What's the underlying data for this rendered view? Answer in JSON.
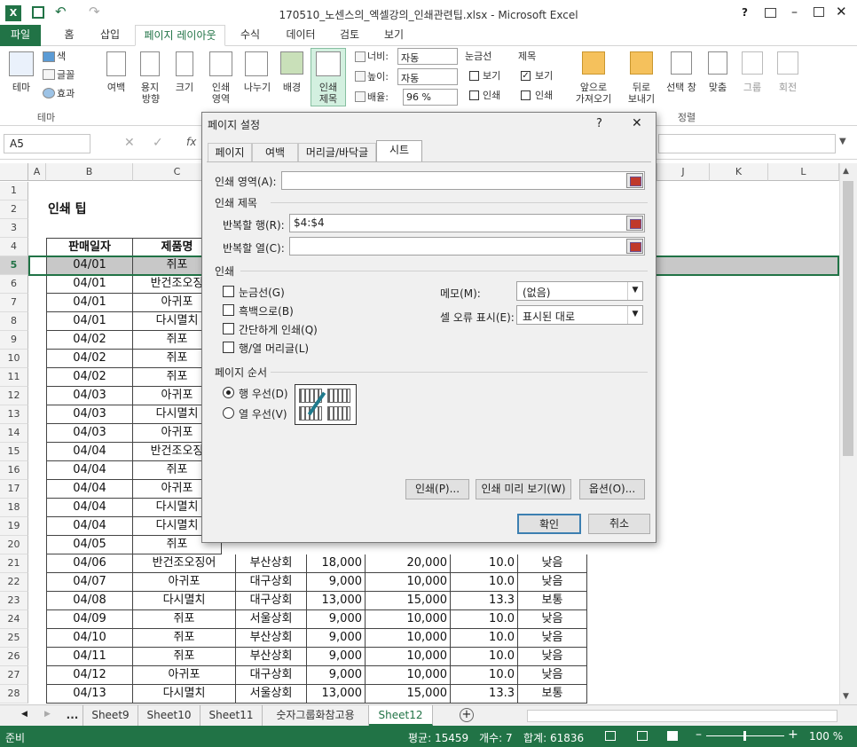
{
  "titlebar": {
    "title": "170510_노센스의_엑셀강의_인쇄관련팁.xlsx - Microsoft Excel",
    "help": "?"
  },
  "tabs": [
    "파일",
    "홈",
    "삽입",
    "페이지 레이아웃",
    "수식",
    "데이터",
    "검토",
    "보기"
  ],
  "ribbon": {
    "theme": {
      "main": "테마",
      "colors": "색",
      "fonts": "글꼴",
      "effects": "효과",
      "group": "테마"
    },
    "setup": {
      "margins": "여백",
      "orientation1": "용지",
      "orientation2": "방향",
      "size": "크기",
      "printarea1": "인쇄",
      "printarea2": "영역",
      "breaks": "나누기",
      "background": "배경",
      "titles1": "인쇄",
      "titles2": "제목"
    },
    "scale": {
      "width_label": "너비:",
      "width_value": "자동",
      "height_label": "높이:",
      "height_value": "자동",
      "scale_label": "배율:",
      "scale_value": "96 %"
    },
    "sheetopts": {
      "gridlines": "눈금선",
      "headings": "제목",
      "view": "보기",
      "print": "인쇄"
    },
    "arrange": {
      "forward1": "앞으로",
      "forward2": "가져오기",
      "backward1": "뒤로",
      "backward2": "보내기",
      "selection": "선택 창",
      "align": "맞춤",
      "group": "그룹",
      "rotate": "회전",
      "group_label": "정렬"
    }
  },
  "formula": {
    "namebox": "A5",
    "fx": "fx"
  },
  "columns": [
    "A",
    "B",
    "C",
    "J",
    "K",
    "L"
  ],
  "rows": [
    {
      "n": "1",
      "b": "",
      "c": ""
    },
    {
      "n": "2",
      "b": "인쇄 팁",
      "c": ""
    },
    {
      "n": "3",
      "b": "",
      "c": ""
    },
    {
      "n": "4",
      "b": "판매일자",
      "c": "제품명"
    },
    {
      "n": "5",
      "b": "04/01",
      "c": "쥐포"
    },
    {
      "n": "6",
      "b": "04/01",
      "c": "반건조오징"
    },
    {
      "n": "7",
      "b": "04/01",
      "c": "아귀포"
    },
    {
      "n": "8",
      "b": "04/01",
      "c": "다시멸치"
    },
    {
      "n": "9",
      "b": "04/02",
      "c": "쥐포"
    },
    {
      "n": "10",
      "b": "04/02",
      "c": "쥐포"
    },
    {
      "n": "11",
      "b": "04/02",
      "c": "쥐포"
    },
    {
      "n": "12",
      "b": "04/03",
      "c": "아귀포"
    },
    {
      "n": "13",
      "b": "04/03",
      "c": "다시멸치"
    },
    {
      "n": "14",
      "b": "04/03",
      "c": "아귀포"
    },
    {
      "n": "15",
      "b": "04/04",
      "c": "반건조오징"
    },
    {
      "n": "16",
      "b": "04/04",
      "c": "쥐포"
    },
    {
      "n": "17",
      "b": "04/04",
      "c": "아귀포"
    },
    {
      "n": "18",
      "b": "04/04",
      "c": "다시멸치"
    },
    {
      "n": "19",
      "b": "04/04",
      "c": "다시멸치"
    },
    {
      "n": "20",
      "b": "04/05",
      "c": "쥐포"
    }
  ],
  "lower_rows": [
    {
      "n": "21",
      "b": "04/06",
      "c": "반건조오징어",
      "d": "부산상회",
      "e": "18,000",
      "f": "20,000",
      "g": "10.0",
      "h": "낮음"
    },
    {
      "n": "22",
      "b": "04/07",
      "c": "아귀포",
      "d": "대구상회",
      "e": "9,000",
      "f": "10,000",
      "g": "10.0",
      "h": "낮음"
    },
    {
      "n": "23",
      "b": "04/08",
      "c": "다시멸치",
      "d": "대구상회",
      "e": "13,000",
      "f": "15,000",
      "g": "13.3",
      "h": "보통"
    },
    {
      "n": "24",
      "b": "04/09",
      "c": "쥐포",
      "d": "서울상회",
      "e": "9,000",
      "f": "10,000",
      "g": "10.0",
      "h": "낮음"
    },
    {
      "n": "25",
      "b": "04/10",
      "c": "쥐포",
      "d": "부산상회",
      "e": "9,000",
      "f": "10,000",
      "g": "10.0",
      "h": "낮음"
    },
    {
      "n": "26",
      "b": "04/11",
      "c": "쥐포",
      "d": "부산상회",
      "e": "9,000",
      "f": "10,000",
      "g": "10.0",
      "h": "낮음"
    },
    {
      "n": "27",
      "b": "04/12",
      "c": "아귀포",
      "d": "대구상회",
      "e": "9,000",
      "f": "10,000",
      "g": "10.0",
      "h": "낮음"
    },
    {
      "n": "28",
      "b": "04/13",
      "c": "다시멸치",
      "d": "서울상회",
      "e": "13,000",
      "f": "15,000",
      "g": "13.3",
      "h": "보통"
    }
  ],
  "sheets": [
    "...",
    "Sheet9",
    "Sheet10",
    "Sheet11",
    "숫자그룹화참고용",
    "Sheet12"
  ],
  "status": {
    "ready": "준비",
    "average": "평균: 15459",
    "count": "개수: 7",
    "sum": "합계: 61836",
    "zoom": "100 %"
  },
  "dialog": {
    "title": "페이지 설정",
    "help": "?",
    "close": "✕",
    "tabs": [
      "페이지",
      "여백",
      "머리글/바닥글",
      "시트"
    ],
    "print_area_label": "인쇄 영역(A):",
    "print_area_value": "",
    "print_titles": "인쇄 제목",
    "rows_repeat_label": "반복할 행(R):",
    "rows_repeat_value": "$4:$4",
    "cols_repeat_label": "반복할 열(C):",
    "cols_repeat_value": "",
    "print_section": "인쇄",
    "opt_gridlines": "눈금선(G)",
    "opt_bw": "흑백으로(B)",
    "opt_draft": "간단하게 인쇄(Q)",
    "opt_headings": "행/열 머리글(L)",
    "comments_label": "메모(M):",
    "comments_value": "(없음)",
    "errors_label": "셀 오류 표시(E):",
    "errors_value": "표시된 대로",
    "page_order": "페이지 순서",
    "order_down": "행 우선(D)",
    "order_over": "열 우선(V)",
    "btn_print": "인쇄(P)...",
    "btn_preview": "인쇄 미리 보기(W)",
    "btn_options": "옵션(O)...",
    "btn_ok": "확인",
    "btn_cancel": "취소"
  }
}
